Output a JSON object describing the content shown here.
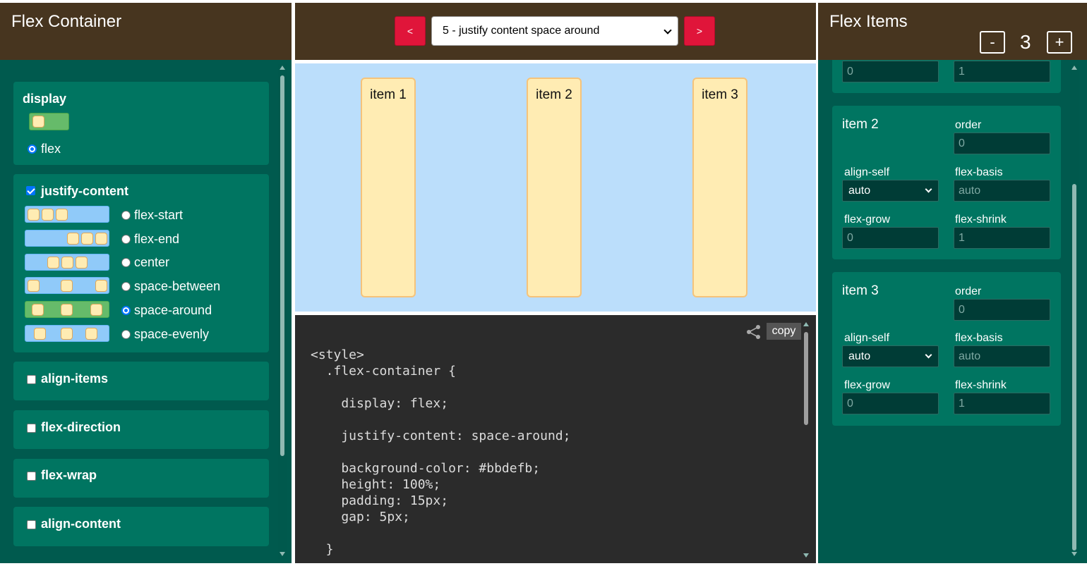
{
  "left": {
    "title": "Flex Container",
    "display": {
      "label": "display",
      "option": "flex",
      "selected": true
    },
    "justify": {
      "label": "justify-content",
      "checked": true,
      "options": [
        "flex-start",
        "flex-end",
        "center",
        "space-between",
        "space-around",
        "space-evenly"
      ],
      "selected": "space-around"
    },
    "sections": [
      {
        "label": "align-items",
        "checked": false
      },
      {
        "label": "flex-direction",
        "checked": false
      },
      {
        "label": "flex-wrap",
        "checked": false
      },
      {
        "label": "align-content",
        "checked": false
      }
    ]
  },
  "center": {
    "prev_label": "<",
    "next_label": ">",
    "lesson": "5 - justify content space around",
    "items": [
      "item 1",
      "item 2",
      "item 3"
    ],
    "copy_label": "copy",
    "code_lines": [
      "<style>",
      "  .flex-container {",
      "",
      "    display: flex;",
      "",
      "    justify-content: space-around;",
      "",
      "    background-color: #bbdefb;",
      "    height: 100%;",
      "    padding: 15px;",
      "    gap: 5px;",
      "",
      "  }"
    ]
  },
  "right": {
    "title": "Flex Items",
    "minus_label": "-",
    "plus_label": "+",
    "count": "3",
    "item1_partial": {
      "order": "0",
      "flex_shrink": "1"
    },
    "items": [
      {
        "name": "item 2",
        "order_label": "order",
        "order": "0",
        "align_self_label": "align-self",
        "align_self": "auto",
        "flex_basis_label": "flex-basis",
        "flex_basis": "auto",
        "flex_grow_label": "flex-grow",
        "flex_grow": "0",
        "flex_shrink_label": "flex-shrink",
        "flex_shrink": "1"
      },
      {
        "name": "item 3",
        "order_label": "order",
        "order": "0",
        "align_self_label": "align-self",
        "align_self": "auto",
        "flex_basis_label": "flex-basis",
        "flex_basis": "auto",
        "flex_grow_label": "flex-grow",
        "flex_grow": "0",
        "flex_shrink_label": "flex-shrink",
        "flex_shrink": "1"
      }
    ]
  },
  "colors": {
    "panel_bg": "#005a4e",
    "card_bg": "#007561",
    "header_bg": "#47351f",
    "accent_red": "#e0153a",
    "preview_bg": "#bbdefb",
    "item_bg": "#ffecb3",
    "code_bg": "#2b2b2b"
  }
}
